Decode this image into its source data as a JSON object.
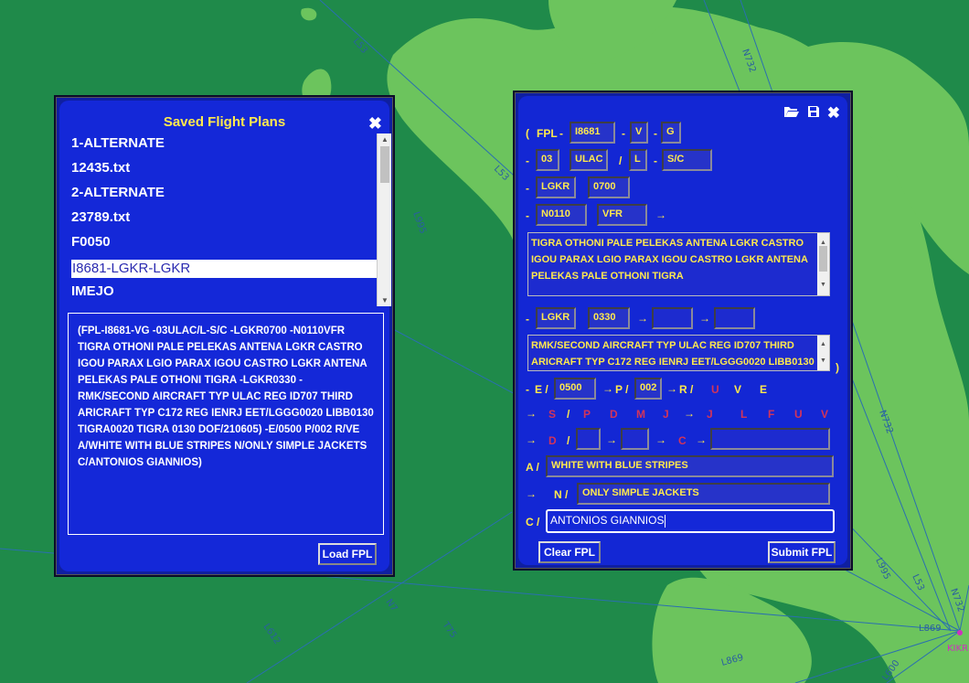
{
  "map": {
    "airway_labels": [
      "L53",
      "N732",
      "L53",
      "L995",
      "N732",
      "L995",
      "L53",
      "N732",
      "N7",
      "L612",
      "T75",
      "L869",
      "L869",
      "L600",
      "L869"
    ],
    "waypoint_label": "KIKR"
  },
  "saved_panel": {
    "title": "Saved Flight Plans",
    "close_icon": "close-icon",
    "files": [
      "1-ALTERNATE",
      "12435.txt",
      "2-ALTERNATE",
      "23789.txt",
      "F0050",
      "I8681-LGKR-LGKR",
      "IMEJO"
    ],
    "selected_index": 5,
    "fpl_text": "(FPL-I8681-VG -03ULAC/L-S/C -LGKR0700 -N0110VFR TIGRA OTHONI PALE PELEKAS ANTENA LGKR CASTRO IGOU PARAX LGIO PARAX IGOU CASTRO LGKR ANTENA PELEKAS PALE OTHONI TIGRA -LGKR0330 -RMK/SECOND AIRCRAFT TYP ULAC REG ID707 THIRD ARICRAFT TYP C172 REG IENRJ EET/LGGG0020 LIBB0130 TIGRA0020 TIGRA 0130 DOF/210605) -E/0500 P/002 R/VE A/WHITE WITH BLUE STRIPES N/ONLY SIMPLE JACKETS C/ANTONIOS GIANNIOS)",
    "load_button": "Load FPL"
  },
  "form": {
    "tool_icons": [
      "folder-open-icon",
      "save-icon",
      "close-icon"
    ],
    "open_paren": "(",
    "fpl_label": "FPL",
    "dash": "-",
    "slash": "/",
    "arrow": "→",
    "callsign": "I8681",
    "flight_rules": "V",
    "flight_type": "G",
    "number": "03",
    "aircraft_type": "ULAC",
    "wake": "L",
    "equipment": "S/C",
    "dep_aerodrome": "LGKR",
    "dep_time": "0700",
    "speed": "N0110",
    "level": "VFR",
    "route": "TIGRA OTHONI PALE PELEKAS ANTENA LGKR CASTRO IGOU PARAX LGIO PARAX IGOU CASTRO LGKR ANTENA PELEKAS PALE OTHONI TIGRA",
    "dest_aerodrome": "LGKR",
    "eet": "0330",
    "altn1": "",
    "altn2": "",
    "other_info": "RMK/SECOND AIRCRAFT TYP ULAC REG ID707 THIRD ARICRAFT TYP C172 REG IENRJ EET/LGGG0020 LIBB0130",
    "close_paren": ")",
    "e_label": "E /",
    "endurance": "0500",
    "p_label": "P /",
    "persons": "002",
    "r_label": "R /",
    "radio_options": [
      "U",
      "V",
      "E"
    ],
    "survival_s": "S",
    "survival_options": [
      "P",
      "D",
      "M",
      "J"
    ],
    "jacket_options": [
      "J",
      "L",
      "F",
      "U",
      "V"
    ],
    "dinghy_d": "D",
    "dinghy_c": "C",
    "a_label": "A /",
    "aircraft_colour": "WHITE WITH BLUE STRIPES",
    "n_label": "N /",
    "remarks": "ONLY SIMPLE JACKETS",
    "c_label": "C /",
    "pilot": "ANTONIOS GIANNIOS",
    "clear_button": "Clear FPL",
    "submit_button": "Submit FPL"
  }
}
